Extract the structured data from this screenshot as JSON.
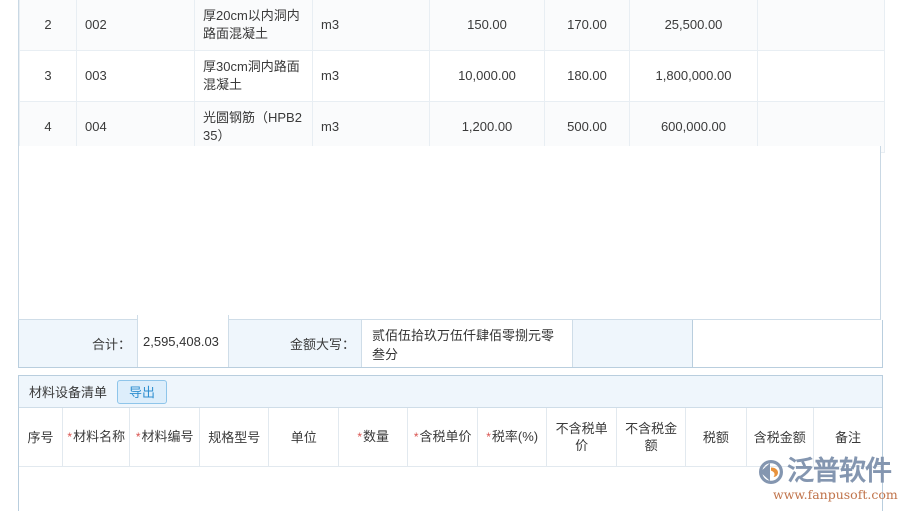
{
  "upper_table": {
    "rows": [
      {
        "index": "2",
        "code": "002",
        "name": "厚20cm以内洞内路面混凝土",
        "unit": "m3",
        "quantity": "150.00",
        "price": "170.00",
        "amount": "25,500.00",
        "note": ""
      },
      {
        "index": "3",
        "code": "003",
        "name": "厚30cm洞内路面混凝土",
        "unit": "m3",
        "quantity": "10,000.00",
        "price": "180.00",
        "amount": "1,800,000.00",
        "note": ""
      },
      {
        "index": "4",
        "code": "004",
        "name": "光圆钢筋（HPB235）",
        "unit": "m3",
        "quantity": "1,200.00",
        "price": "500.00",
        "amount": "600,000.00",
        "note": ""
      }
    ]
  },
  "summary": {
    "total_label": "合计：",
    "total_value": "2,595,408.03",
    "upper_label": "金额大写：",
    "upper_value": "贰佰伍拾玖万伍仟肆佰零捌元零叁分"
  },
  "material_panel": {
    "title": "材料设备清单",
    "export_label": "导出",
    "columns": [
      {
        "label": "序号",
        "required": false
      },
      {
        "label": "材料名称",
        "required": true
      },
      {
        "label": "材料编号",
        "required": true
      },
      {
        "label": "规格型号",
        "required": false
      },
      {
        "label": "单位",
        "required": false
      },
      {
        "label": "数量",
        "required": true
      },
      {
        "label": "含税单价",
        "required": true
      },
      {
        "label": "税率(%)",
        "required": true
      },
      {
        "label": "不含税单价",
        "required": false
      },
      {
        "label": "不含税金额",
        "required": false
      },
      {
        "label": "税额",
        "required": false
      },
      {
        "label": "含税金额",
        "required": false
      },
      {
        "label": "备注",
        "required": false
      }
    ],
    "rows": []
  },
  "watermark": {
    "brand": "泛普软件",
    "url": "www.fanpusoft.com"
  },
  "colors": {
    "panel_header_bg": "#eff6fc",
    "border": "#b9cede",
    "accent": "#2f8fd0",
    "required_star": "#d9534f",
    "watermark_text": "#8496b0",
    "watermark_url": "#c0734a"
  }
}
